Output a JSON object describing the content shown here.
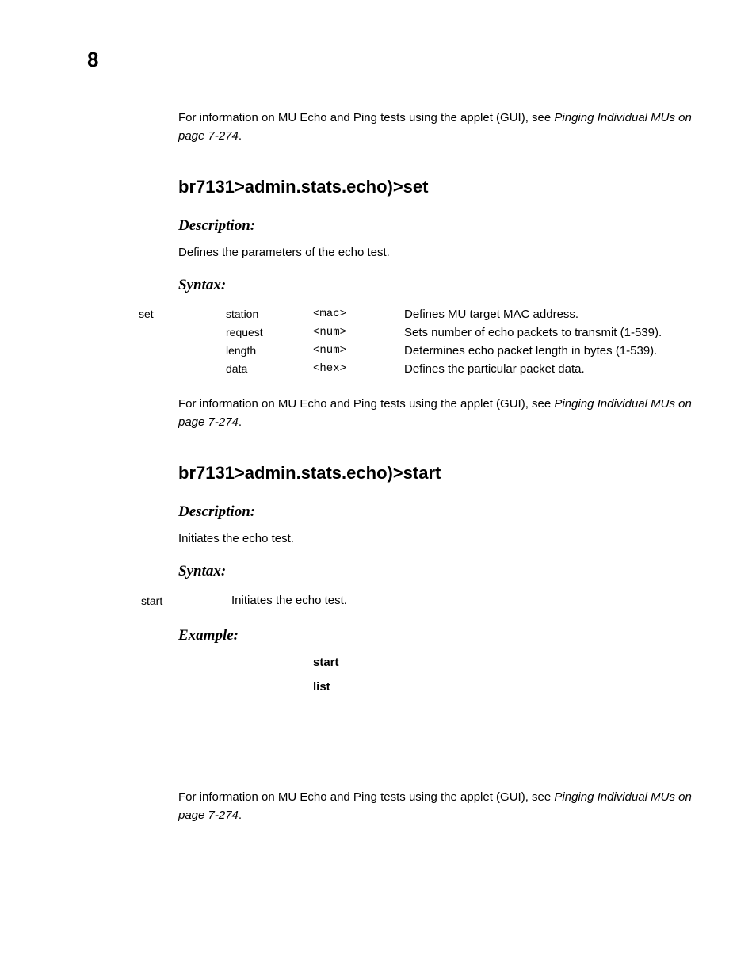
{
  "page_number": "8",
  "info_prefix": "For information on MU Echo and Ping tests using the applet (GUI), see ",
  "info_link": "Pinging Individual MUs on page 7-274",
  "info_suffix": ".",
  "section_set": {
    "heading": "br7131>admin.stats.echo)>set",
    "desc_label": "Description:",
    "desc_text": "Defines the parameters of the echo test.",
    "syntax_label": "Syntax:",
    "cmd": "set",
    "rows": [
      {
        "param": "station",
        "arg": "<mac>",
        "desc": "Defines MU target MAC address."
      },
      {
        "param": "request",
        "arg": "<num>",
        "desc": "Sets number of echo packets to transmit (1-539)."
      },
      {
        "param": "length",
        "arg": "<num>",
        "desc": "Determines echo packet length in bytes (1-539)."
      },
      {
        "param": "data",
        "arg": "<hex>",
        "desc": "Defines the particular packet data."
      }
    ]
  },
  "section_start": {
    "heading": "br7131>admin.stats.echo)>start",
    "desc_label": "Description:",
    "desc_text": "Initiates the echo test.",
    "syntax_label": "Syntax:",
    "cmd": "start",
    "cmd_desc": "Initiates the echo test.",
    "example_label": "Example:",
    "example_lines": [
      "start",
      "list"
    ]
  }
}
